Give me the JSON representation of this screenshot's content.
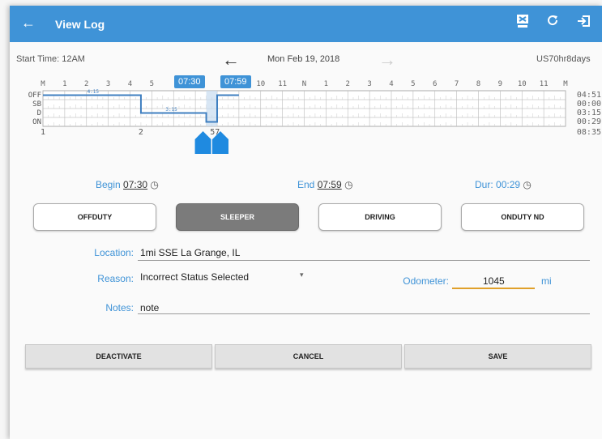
{
  "appbar": {
    "title": "View Log",
    "back_icon": "arrow-left-icon",
    "actions": [
      "inspect-icon",
      "refresh-icon",
      "logout-icon"
    ]
  },
  "header": {
    "start_time": "Start Time: 12AM",
    "date": "Mon Feb 19, 2018",
    "ruleset": "US70hr8days"
  },
  "graph": {
    "hours": [
      "M",
      "1",
      "2",
      "3",
      "4",
      "5",
      "",
      "",
      "",
      "",
      "10",
      "11",
      "N",
      "1",
      "2",
      "3",
      "4",
      "5",
      "6",
      "7",
      "8",
      "9",
      "10",
      "11",
      "M"
    ],
    "rows": [
      "OFF",
      "SB",
      "D",
      "ON"
    ],
    "totals": [
      "04:51",
      "00:00",
      "03:15",
      "00:29"
    ],
    "grand_total": "08:35",
    "segment_labels": [
      "4:15",
      "3:15"
    ],
    "bottom_marks": [
      "1",
      "2",
      "57"
    ],
    "selected_begin": "07:30",
    "selected_end": "07:59"
  },
  "selection": {
    "begin_label": "Begin",
    "begin_value": "07:30",
    "end_label": "End",
    "end_value": "07:59",
    "dur_label": "Dur:",
    "dur_value": "00:29"
  },
  "statuses": [
    {
      "label": "OFFDUTY",
      "active": false
    },
    {
      "label": "SLEEPER",
      "active": true
    },
    {
      "label": "DRIVING",
      "active": false
    },
    {
      "label": "ONDUTY ND",
      "active": false
    }
  ],
  "form": {
    "location_label": "Location:",
    "location_value": "1mi SSE La Grange, IL",
    "reason_label": "Reason:",
    "reason_value": "Incorrect Status Selected",
    "odometer_label": "Odometer:",
    "odometer_value": "1045",
    "odometer_unit": "mi",
    "notes_label": "Notes:",
    "notes_value": "note"
  },
  "buttons": {
    "deactivate": "DEACTIVATE",
    "cancel": "CANCEL",
    "save": "SAVE"
  },
  "colors": {
    "primary": "#3f93d7",
    "active_status": "#7b7b7b",
    "odometer_focus": "#e0a02a"
  }
}
